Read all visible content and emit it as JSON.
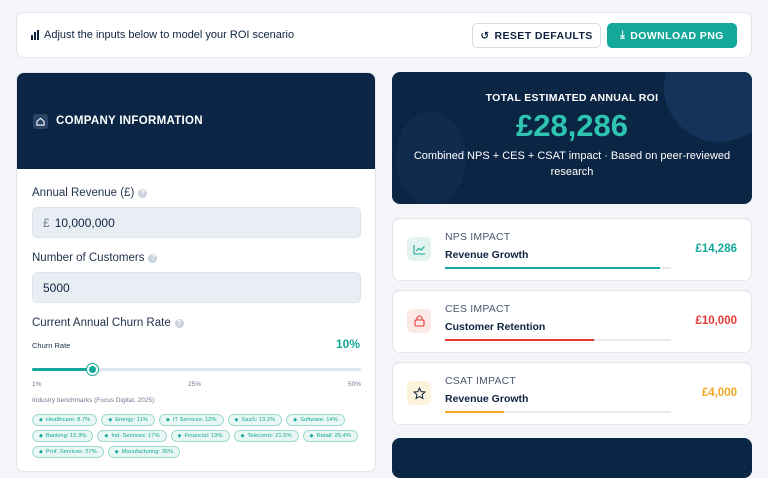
{
  "topbar": {
    "intro": "Adjust the inputs below to model your ROI scenario",
    "reset_label": "RESET DEFAULTS",
    "download_label": "DOWNLOAD PNG",
    "icons": {
      "intro": "bar-chart-icon",
      "reset": "refresh-icon",
      "download": "download-icon"
    }
  },
  "company": {
    "title": "COMPANY INFORMATION",
    "revenue_label": "Annual Revenue (£)",
    "revenue_currency": "£",
    "revenue_value": "10,000,000",
    "customers_label": "Number of Customers",
    "customers_value": "5000",
    "churn_label": "Current Annual Churn Rate",
    "churn_small_label": "Churn Rate",
    "churn_value": "10%",
    "churn_min": 1,
    "churn_max": 50,
    "churn_current": 10,
    "ticks": [
      "1%",
      "25%",
      "50%"
    ],
    "bench_title": "Industry benchmarks (Focus Digital, 2025):",
    "benchmarks": [
      "Healthcare: 8.7%",
      "Energy: 11%",
      "IT Services: 12%",
      "SaaS: 13.2%",
      "Software: 14%",
      "Banking: 15.3%",
      "Ind. Services: 17%",
      "Financial: 19%",
      "Telecoms: 21.5%",
      "Retail: 25.4%",
      "Prof. Services: 27%",
      "Manufacturing: 35%"
    ]
  },
  "roi": {
    "label": "TOTAL ESTIMATED ANNUAL ROI",
    "value": "£28,286",
    "subtitle": "Combined NPS + CES + CSAT impact · Based on peer-reviewed research"
  },
  "impacts": [
    {
      "name": "NPS IMPACT",
      "sub": "Revenue Growth",
      "amount": "£14,286",
      "color": "#13a89a",
      "bg": "#e3f3f0",
      "icon": "trend-chart-icon",
      "fill": 0.95
    },
    {
      "name": "CES IMPACT",
      "sub": "Customer Retention",
      "amount": "£10,000",
      "color": "#e53935",
      "bg": "#fde8e8",
      "icon": "lock-icon",
      "fill": 0.66
    },
    {
      "name": "CSAT IMPACT",
      "sub": "Revenue Growth",
      "amount": "£4,000",
      "color": "#f5a623",
      "bg": "#fdf2dc",
      "icon": "star-icon",
      "fill": 0.26
    }
  ]
}
